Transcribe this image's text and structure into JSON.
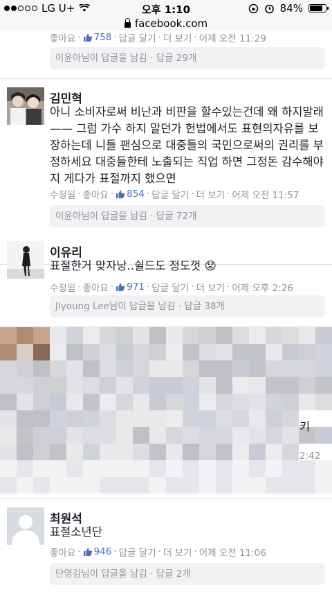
{
  "status": {
    "carrier": "LG U+",
    "time": "오후 1:10",
    "battery": "84%",
    "battery_level": 0.84
  },
  "browser": {
    "url": "facebook.com"
  },
  "comments": [
    {
      "meta": {
        "like": "좋아요",
        "likes": "758",
        "reply": "답글 달기",
        "more": "더 보기",
        "time": "어제 오전 11:29"
      },
      "replies": "이윤아님이 답글을 남김 · 답글 29개"
    },
    {
      "name": "김민혁",
      "text": "아니 소비자로써 비난과 비판을 할수있는건데 왜 하지말래 —— 그럼 가수 하지 말던가 헌법에서도 표현의자유를 보장하는데 니들 팬심으로 대중들의 국민으로써의 권리를 부정하세요 대중들한테 노출되는 직업 하면 그정돈 감수해야지 게다가 표절까지 했으면",
      "meta": {
        "edited": "수정됨",
        "like": "좋아요",
        "likes": "854",
        "reply": "답글 달기",
        "more": "더 보기",
        "time": "어제 오전 11:57"
      },
      "replies": "이윤아님이 답글을 남김 · 답글 72개"
    },
    {
      "name": "이유리",
      "text": "표절한거 맞자낭..쉴드도 정도껏 😟",
      "meta": {
        "edited": "수정됨",
        "like": "좋아요",
        "likes": "971",
        "reply": "답글 달기",
        "more": "더 보기",
        "time": "어제 오후 2:26"
      },
      "replies": "Jiyoung Lee님이 답글을 남김 · 답글 38개"
    },
    {
      "partial_text": "키",
      "partial_time": "2:42"
    },
    {
      "name": "최원석",
      "text": "표절소년단",
      "meta": {
        "like": "좋아요",
        "likes": "946",
        "reply": "답글 달기",
        "more": "더 보기",
        "time": "어제 오전 11:06"
      },
      "replies": "단영김님이 답글을 남김 · 답글 2개"
    }
  ],
  "colors": {
    "link": "#4b6fb5",
    "meta": "#90949c",
    "reply_bg": "#f1f2f4"
  }
}
